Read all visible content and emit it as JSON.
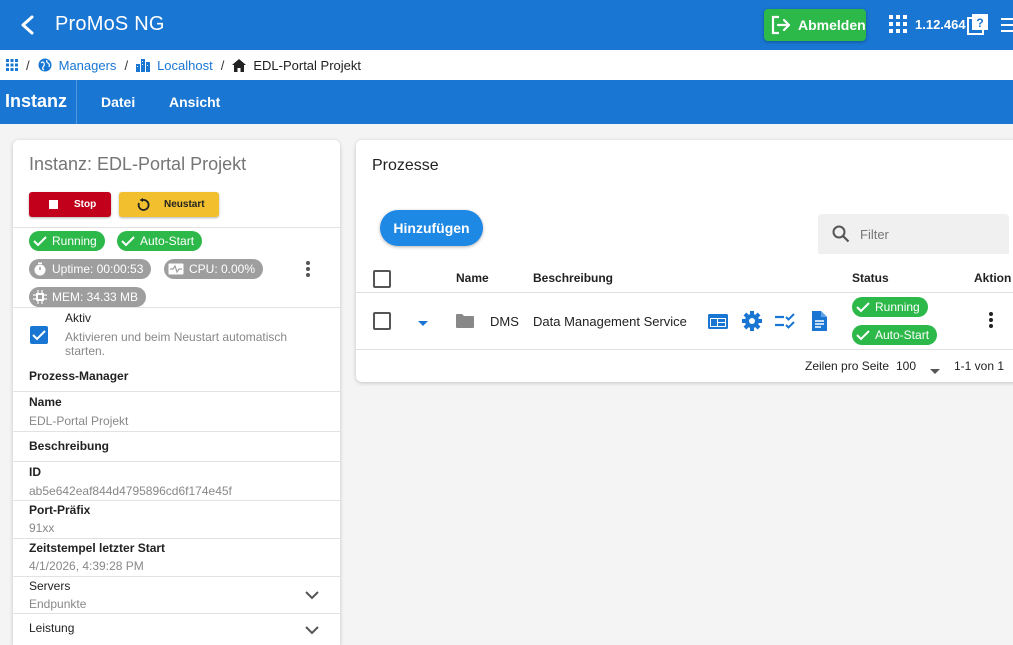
{
  "app": {
    "title": "ProMoS NG",
    "logout_label": "Abmelden",
    "version": "1.12.464"
  },
  "breadcrumb": {
    "items": [
      {
        "label": "Managers"
      },
      {
        "label": "Localhost"
      },
      {
        "label": "EDL-Portal Projekt"
      }
    ],
    "separator": "/"
  },
  "toolbar": {
    "section": "Instanz",
    "menus": [
      "Datei",
      "Ansicht"
    ]
  },
  "instance": {
    "title": "Instanz: EDL-Portal Projekt",
    "stop_label": "Stop",
    "restart_label": "Neustart",
    "status_chips": [
      "Running",
      "Auto-Start"
    ],
    "stats": {
      "uptime": "Uptime: 00:00:53",
      "cpu": "CPU: 0.00%",
      "mem": "MEM: 34.33 MB"
    },
    "aktiv_label": "Aktiv",
    "aktiv_desc": "Aktivieren und beim Neustart automatisch starten.",
    "process_manager_label": "Prozess-Manager",
    "fields": {
      "name": {
        "label": "Name",
        "value": "EDL-Portal Projekt"
      },
      "description": {
        "label": "Beschreibung"
      },
      "id": {
        "label": "ID",
        "value": "ab5e642eaf844d4795896cd6f174e45f"
      },
      "port": {
        "label": "Port-Präfix",
        "value": "91xx"
      },
      "last_start": {
        "label": "Zeitstempel letzter Start",
        "value": "4/1/2026, 4:39:28 PM"
      },
      "servers": {
        "label": "Servers",
        "value": "Endpunkte"
      },
      "performance": {
        "label": "Leistung"
      }
    }
  },
  "processes": {
    "title": "Prozesse",
    "add_label": "Hinzufügen",
    "filter_placeholder": "Filter",
    "columns": {
      "name": "Name",
      "description": "Beschreibung",
      "status": "Status",
      "action": "Aktion"
    },
    "rows": [
      {
        "name": "DMS",
        "description": "Data Management Service",
        "status": [
          "Running",
          "Auto-Start"
        ]
      }
    ],
    "footer": {
      "rows_per_page_label": "Zeilen pro Seite",
      "rows_per_page": "100",
      "range": "1-1 von 1"
    }
  },
  "colors": {
    "primary": "#1976d2",
    "success": "#2db84a",
    "danger": "#c3001c",
    "warning": "#f2c02e",
    "chip_grey": "#9e9e9e"
  }
}
